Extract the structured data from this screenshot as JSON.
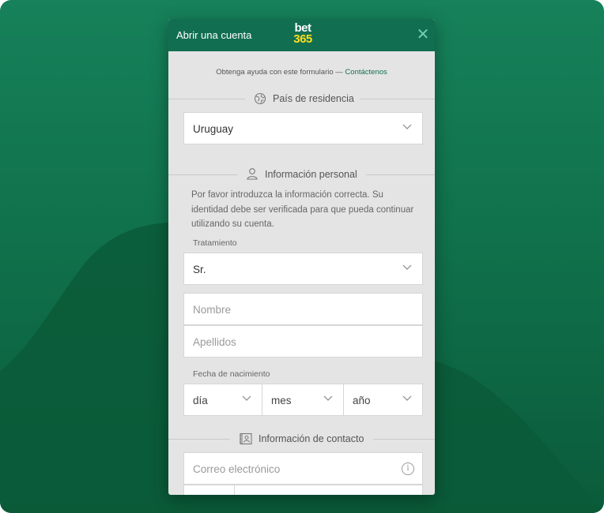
{
  "header": {
    "title": "Abrir una cuenta",
    "logo_top": "bet",
    "logo_bottom": "365",
    "close_icon": "close-icon"
  },
  "help": {
    "text": "Obtenga ayuda con este formulario —",
    "link": "Contáctenos"
  },
  "residence": {
    "section_label": "País de residencia",
    "icon": "globe-icon",
    "country_value": "Uruguay"
  },
  "personal": {
    "section_label": "Información personal",
    "icon": "user-icon",
    "description": "Por favor introduzca la información correcta. Su identidad debe ser verificada para que pueda continuar utilizando su cuenta.",
    "title_caption": "Tratamiento",
    "title_value": "Sr.",
    "first_name_placeholder": "Nombre",
    "last_name_placeholder": "Apellidos",
    "dob_caption": "Fecha de nacimiento",
    "day_placeholder": "día",
    "month_placeholder": "mes",
    "year_placeholder": "año"
  },
  "contact": {
    "section_label": "Información de contacto",
    "icon": "address-book-icon",
    "email_placeholder": "Correo electrónico",
    "info_icon": "info-icon"
  },
  "colors": {
    "brand_green": "#126e51",
    "logo_yellow": "#ffdf1b",
    "background_green": "#16815a"
  }
}
